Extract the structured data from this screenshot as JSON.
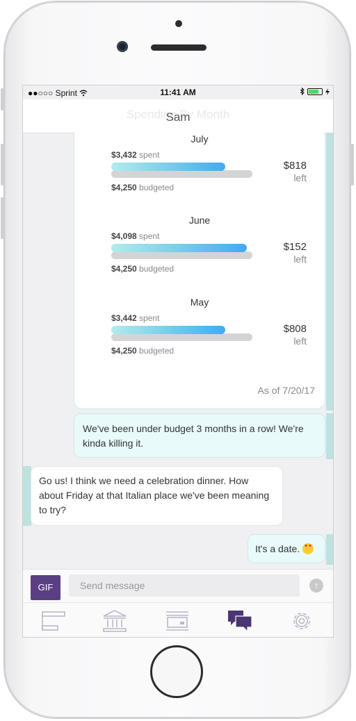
{
  "status": {
    "carrier": "●●○○○ Sprint",
    "wifi": "wifi-icon",
    "time": "11:41 AM",
    "bluetooth": "bluetooth-icon",
    "battery": "battery-icon",
    "charging": "charging-icon"
  },
  "header": {
    "ghost_title": "Spending By Month",
    "title": "Sam"
  },
  "spending_card": {
    "months": [
      {
        "name": "July",
        "spent": "$3,432",
        "spent_label": "spent",
        "budgeted": "$4,250",
        "budgeted_label": "budgeted",
        "left": "$818",
        "left_label": "left",
        "spent_fraction": 0.81
      },
      {
        "name": "June",
        "spent": "$4,098",
        "spent_label": "spent",
        "budgeted": "$4,250",
        "budgeted_label": "budgeted",
        "left": "$152",
        "left_label": "left",
        "spent_fraction": 0.96
      },
      {
        "name": "May",
        "spent": "$3,442",
        "spent_label": "spent",
        "budgeted": "$4,250",
        "budgeted_label": "budgeted",
        "left": "$808",
        "left_label": "left",
        "spent_fraction": 0.81
      }
    ],
    "as_of": "As of 7/20/17"
  },
  "messages": [
    {
      "side": "right",
      "text": "We've been under budget 3 months in a row! We're kinda killing it."
    },
    {
      "side": "left",
      "text": "Go us! I think we need a celebration dinner. How about Friday at that Italian place we've been meaning to try?"
    },
    {
      "side": "right",
      "text": "It's a date."
    }
  ],
  "input": {
    "gif_label": "GIF",
    "placeholder": "Send message",
    "send_icon": "arrow-up-icon"
  },
  "tabs": [
    {
      "icon": "timeline-icon"
    },
    {
      "icon": "bank-icon"
    },
    {
      "icon": "transactions-icon"
    },
    {
      "icon": "chat-icon",
      "active": true
    },
    {
      "icon": "gear-icon"
    }
  ],
  "colors": {
    "accent": "#5a3f84",
    "bubble_right": "#e8fafa",
    "bar_fill_end": "#43aaf0"
  }
}
